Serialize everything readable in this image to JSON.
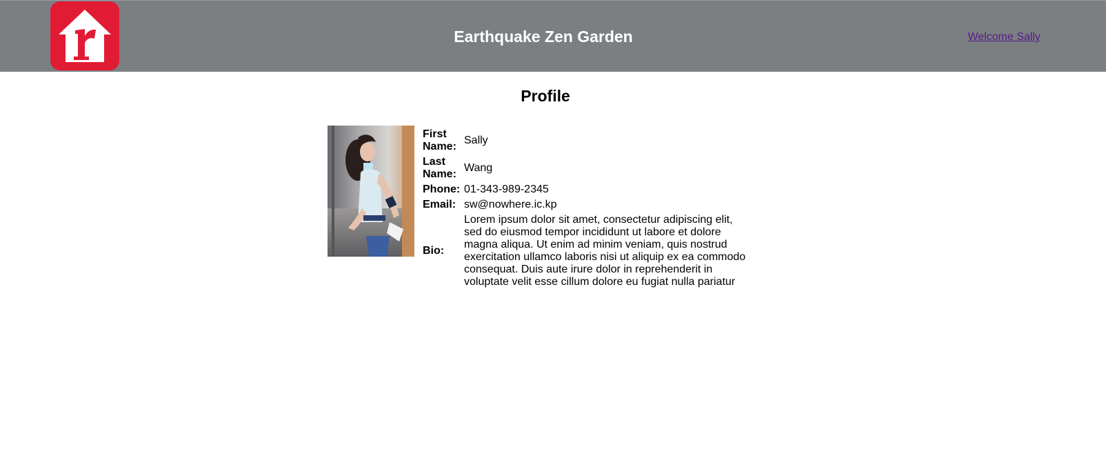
{
  "header": {
    "app_title": "Earthquake Zen Garden",
    "welcome_link": "Welcome Sally",
    "logo_icon": "house-r-logo-icon",
    "colors": {
      "header_bg": "#7c7f82",
      "logo_red": "#e21b35",
      "link": "#551a8b"
    }
  },
  "main": {
    "page_title": "Profile",
    "photo_icon": "profile-photo",
    "fields": {
      "first_name": {
        "label": "First Name:",
        "value": "Sally"
      },
      "last_name": {
        "label": "Last Name:",
        "value": "Wang"
      },
      "phone": {
        "label": "Phone:",
        "value": "01-343-989-2345"
      },
      "email": {
        "label": "Email:",
        "value": "sw@nowhere.ic.kp"
      },
      "bio": {
        "label": "Bio:",
        "value": "Lorem ipsum dolor sit amet, consectetur adipiscing elit, sed do eiusmod tempor incididunt ut labore et dolore magna aliqua. Ut enim ad minim veniam, quis nostrud exercitation ullamco laboris nisi ut aliquip ex ea commodo consequat. Duis aute irure dolor in reprehenderit in voluptate velit esse cillum dolore eu fugiat nulla pariatur"
      }
    }
  }
}
